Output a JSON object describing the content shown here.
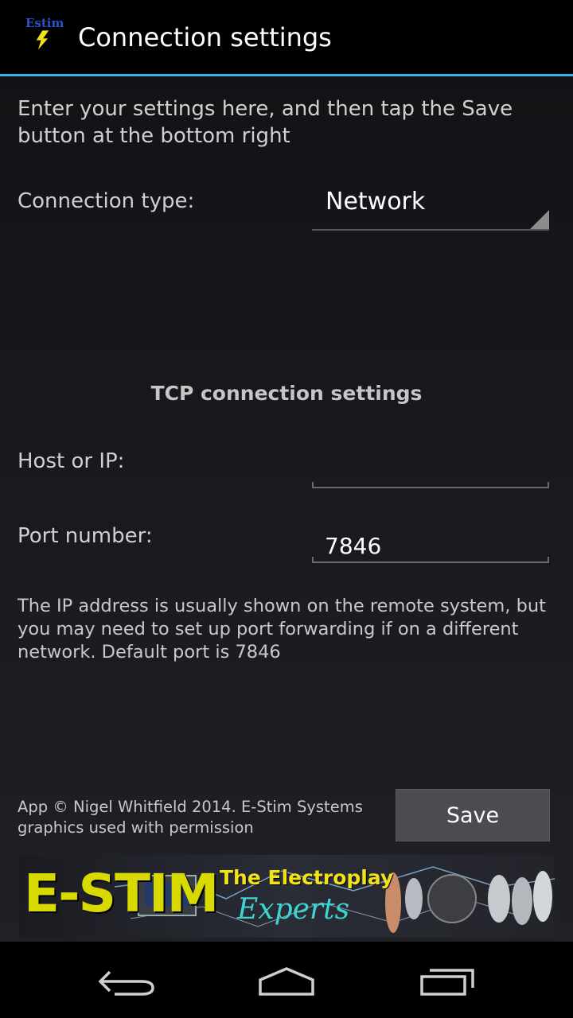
{
  "action_bar": {
    "icon_label": "Estim",
    "title": "Connection settings"
  },
  "intro_text": "Enter your settings here, and then tap the Save button at the bottom right",
  "connection": {
    "label": "Connection type:",
    "selected": "Network"
  },
  "tcp": {
    "section_title": "TCP connection settings",
    "host_label": "Host or IP:",
    "host_value": "",
    "port_label": "Port number:",
    "port_value": "7846"
  },
  "hint_text": "The IP address is usually shown on the remote system, but you may need to set up port forwarding if on a different network. Default port is 7846",
  "footer": {
    "copyright": "App © Nigel Whitfield 2014. E-Stim Systems graphics used with permission",
    "save_label": "Save"
  },
  "banner": {
    "brand": "E-STIM",
    "tagline_1": "The Electroplay",
    "tagline_2": "Experts"
  },
  "colors": {
    "accent": "#33b5e5",
    "background": "#1a1b1f",
    "banner_yellow": "#d7d900",
    "banner_cyan": "#3fd4cf"
  },
  "nav_icons": [
    "back-icon",
    "home-icon",
    "recent-apps-icon"
  ]
}
